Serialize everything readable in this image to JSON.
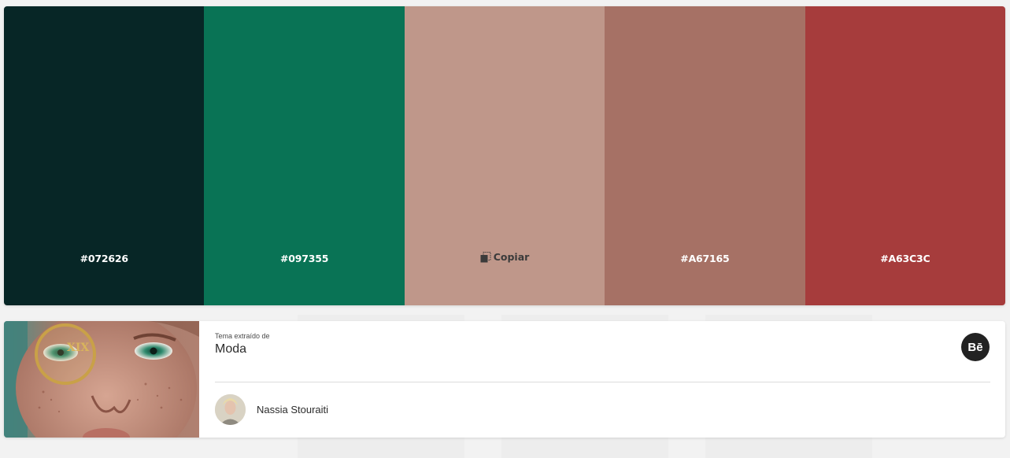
{
  "palette": {
    "swatches": [
      {
        "color": "#072626",
        "label": "#072626",
        "text_color": "#ffffff"
      },
      {
        "color": "#097355",
        "label": "#097355",
        "text_color": "#ffffff"
      },
      {
        "color": "#BF978A",
        "label": "",
        "text_color": "#3b3b3b"
      },
      {
        "color": "#A67165",
        "label": "#A67165",
        "text_color": "#ffffff"
      },
      {
        "color": "#A63C3C",
        "label": "#A63C3C",
        "text_color": "#ffffff"
      }
    ],
    "copy_label": "Copiar",
    "copy_icon": "copy-icon"
  },
  "theme_card": {
    "extracted_from_label": "Tema extraído de",
    "theme_name": "Moda",
    "source_badge": "Bē",
    "source_icon": "behance-icon",
    "author_name": "Nassia Stouraiti"
  }
}
